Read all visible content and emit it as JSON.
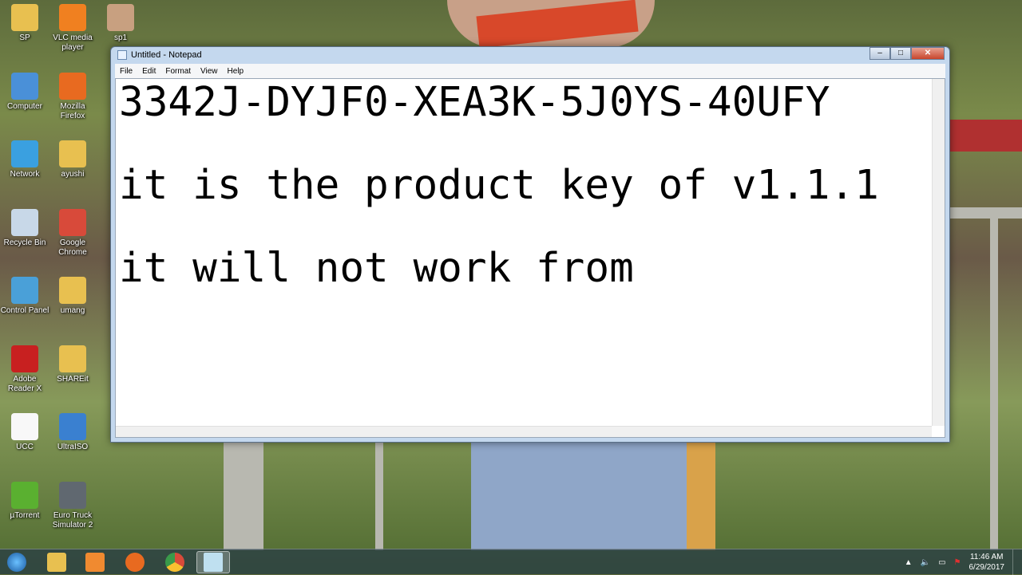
{
  "desktop": {
    "icons": [
      {
        "label": "SP",
        "color": "#e8c050"
      },
      {
        "label": "VLC media player",
        "color": "#f08020"
      },
      {
        "label": "sp1",
        "color": "#c8a080"
      },
      {
        "label": "Computer",
        "color": "#4a90d8"
      },
      {
        "label": "Mozilla Firefox",
        "color": "#e86a20"
      },
      {
        "label": "Network",
        "color": "#3aa0e0"
      },
      {
        "label": "ayushi",
        "color": "#e8c050"
      },
      {
        "label": "Recycle Bin",
        "color": "#c8d8e8"
      },
      {
        "label": "Google Chrome",
        "color": "#d84a3a"
      },
      {
        "label": "Control Panel",
        "color": "#4aa0d8"
      },
      {
        "label": "umang",
        "color": "#e8c050"
      },
      {
        "label": "Adobe Reader X",
        "color": "#c82020"
      },
      {
        "label": "SHAREit",
        "color": "#e8c050"
      },
      {
        "label": "UCC",
        "color": "#f8f8f8"
      },
      {
        "label": "UltraISO",
        "color": "#3a80d0"
      },
      {
        "label": "µTorrent",
        "color": "#5ab030"
      },
      {
        "label": "Euro Truck Simulator 2",
        "color": "#606870"
      }
    ]
  },
  "notepad": {
    "title": "Untitled - Notepad",
    "window_controls": [
      "minimize",
      "maximize",
      "close"
    ],
    "menu": [
      "File",
      "Edit",
      "Format",
      "View",
      "Help"
    ],
    "content": "3342J-DYJF0-XEA3K-5J0YS-40UFY\n\nit is the product key of v1.1.1\n\nit will not work from"
  },
  "taskbar": {
    "items": [
      "start",
      "windows-explorer",
      "media-player",
      "firefox",
      "chrome",
      "notepad"
    ],
    "time": "11:46 AM",
    "date": "6/29/2017"
  }
}
